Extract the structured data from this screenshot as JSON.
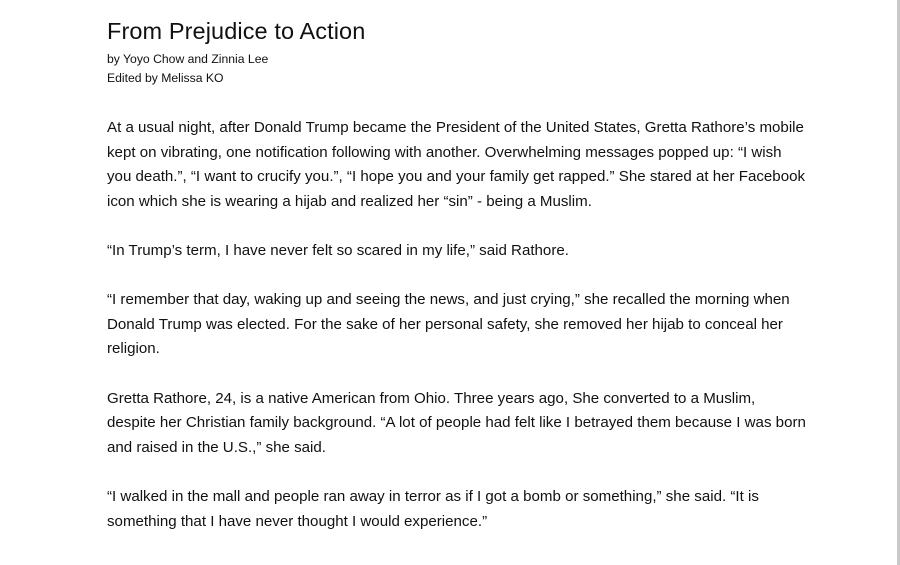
{
  "article": {
    "title": "From Prejudice to Action",
    "byline": "by Yoyo Chow and Zinnia Lee",
    "editor": "Edited by Melissa KO",
    "paragraphs": [
      "At a usual night, after Donald Trump became the President of the United States, Gretta Rathore’s mobile kept on vibrating, one notification following with another. Overwhelming messages popped up: “I wish you death.”, “I want to crucify you.”, “I hope you and your family get rapped.” She stared at her Facebook icon which she is wearing a hijab and realized her “sin” - being a Muslim.",
      "“In Trump’s term, I have never felt so scared in my life,” said Rathore.",
      "“I remember that day, waking up and seeing the news, and just crying,” she recalled the morning when Donald Trump was elected. For the sake of her personal safety, she removed her hijab to conceal her religion.",
      "Gretta Rathore, 24, is a native American from Ohio. Three years ago, She converted to a Muslim, despite her Christian family background. “A lot of people had felt like I betrayed them because I was born and raised in the U.S.,” she said.",
      "“I walked in the mall and people ran away in terror as if I got a bomb or something,” she said. “It is something that I have never thought I would experience.”"
    ]
  }
}
